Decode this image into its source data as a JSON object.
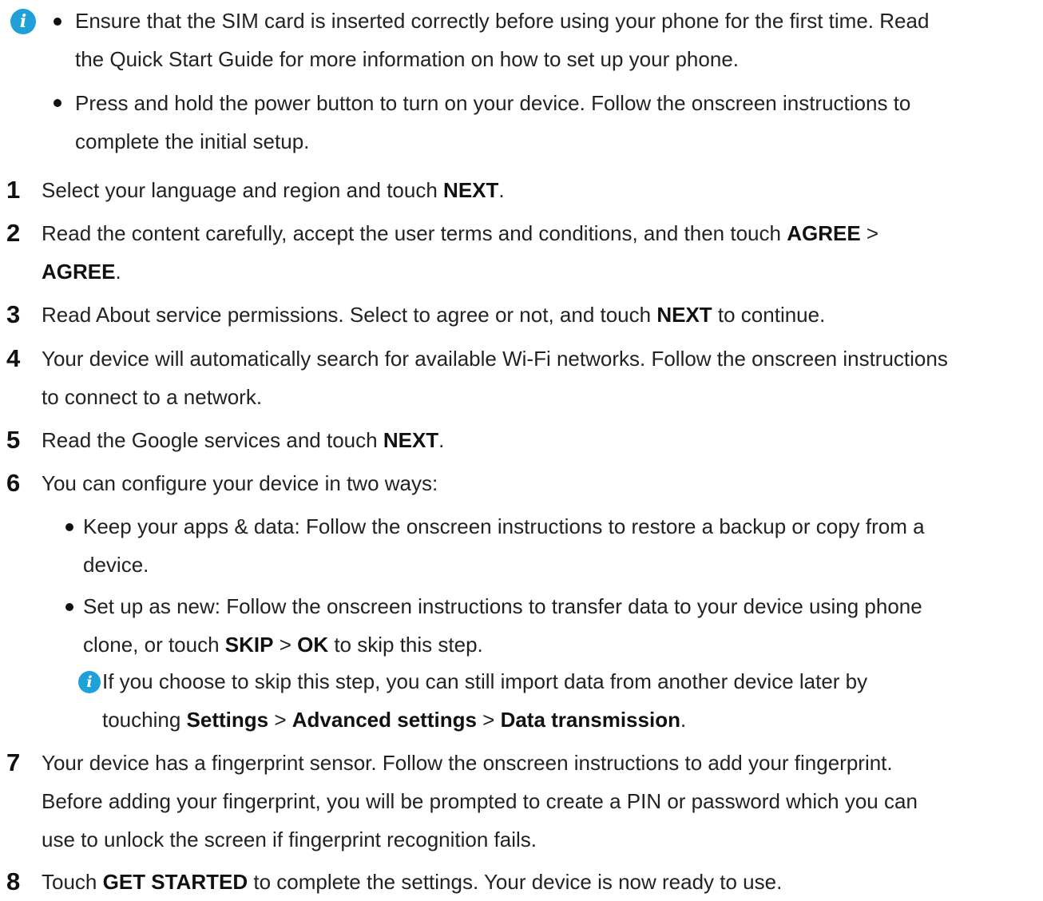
{
  "top_note": {
    "icon": "info-icon",
    "bullets": [
      {
        "line1": "Ensure that the SIM card is inserted correctly before using your phone for the first time. Read",
        "line2": "the Quick Start Guide for more information on how to set up your phone."
      },
      {
        "line1": "Press and hold the power button to turn on your device. Follow the onscreen instructions to",
        "line2": "complete the initial setup."
      }
    ]
  },
  "steps": [
    {
      "num": "1",
      "pre": "Select your language and region and touch ",
      "b1": "NEXT",
      "post": "."
    },
    {
      "num": "2",
      "pre": "Read the content carefully, accept the user terms and conditions, and then touch ",
      "b1": "AGREE",
      "mid": " >",
      "b2": "AGREE",
      "post": "."
    },
    {
      "num": "3",
      "pre": "Read About service permissions. Select to agree or not, and touch ",
      "b1": "NEXT",
      "post": " to continue."
    },
    {
      "num": "4",
      "line1": "Your device will automatically search for available Wi-Fi networks. Follow the onscreen instructions",
      "line2": "to connect to a network."
    },
    {
      "num": "5",
      "pre": "Read the Google services and touch ",
      "b1": "NEXT",
      "post": "."
    },
    {
      "num": "6",
      "text": "You can configure your device in two ways:"
    },
    {
      "num": "7",
      "line1": "Your device has a fingerprint sensor. Follow the onscreen instructions to add your fingerprint.",
      "line2": "Before adding your fingerprint, you will be prompted to create a PIN or password which you can",
      "line3": "use to unlock the screen if fingerprint recognition fails."
    },
    {
      "num": "8",
      "pre": "Touch ",
      "b1": "GET STARTED",
      "post": " to complete the settings. Your device is now ready to use."
    }
  ],
  "step6_options": [
    {
      "line1": "Keep your apps & data: Follow the onscreen instructions to restore a backup or copy from a",
      "line2": "device."
    },
    {
      "line1": "Set up as new: Follow the onscreen instructions to transfer data to your device using phone",
      "line2_pre": "clone, or touch ",
      "b1": "SKIP",
      "sep": " > ",
      "b2": "OK",
      "line2_post": " to skip this step."
    }
  ],
  "step6_note": {
    "icon": "info-icon",
    "line1": "If you choose to skip this step, you can still import data from another device later by",
    "line2_pre": "touching ",
    "b1": "Settings",
    "sep1": " > ",
    "b2": "Advanced settings",
    "sep2": " > ",
    "b3": "Data transmission",
    "line2_post": "."
  }
}
